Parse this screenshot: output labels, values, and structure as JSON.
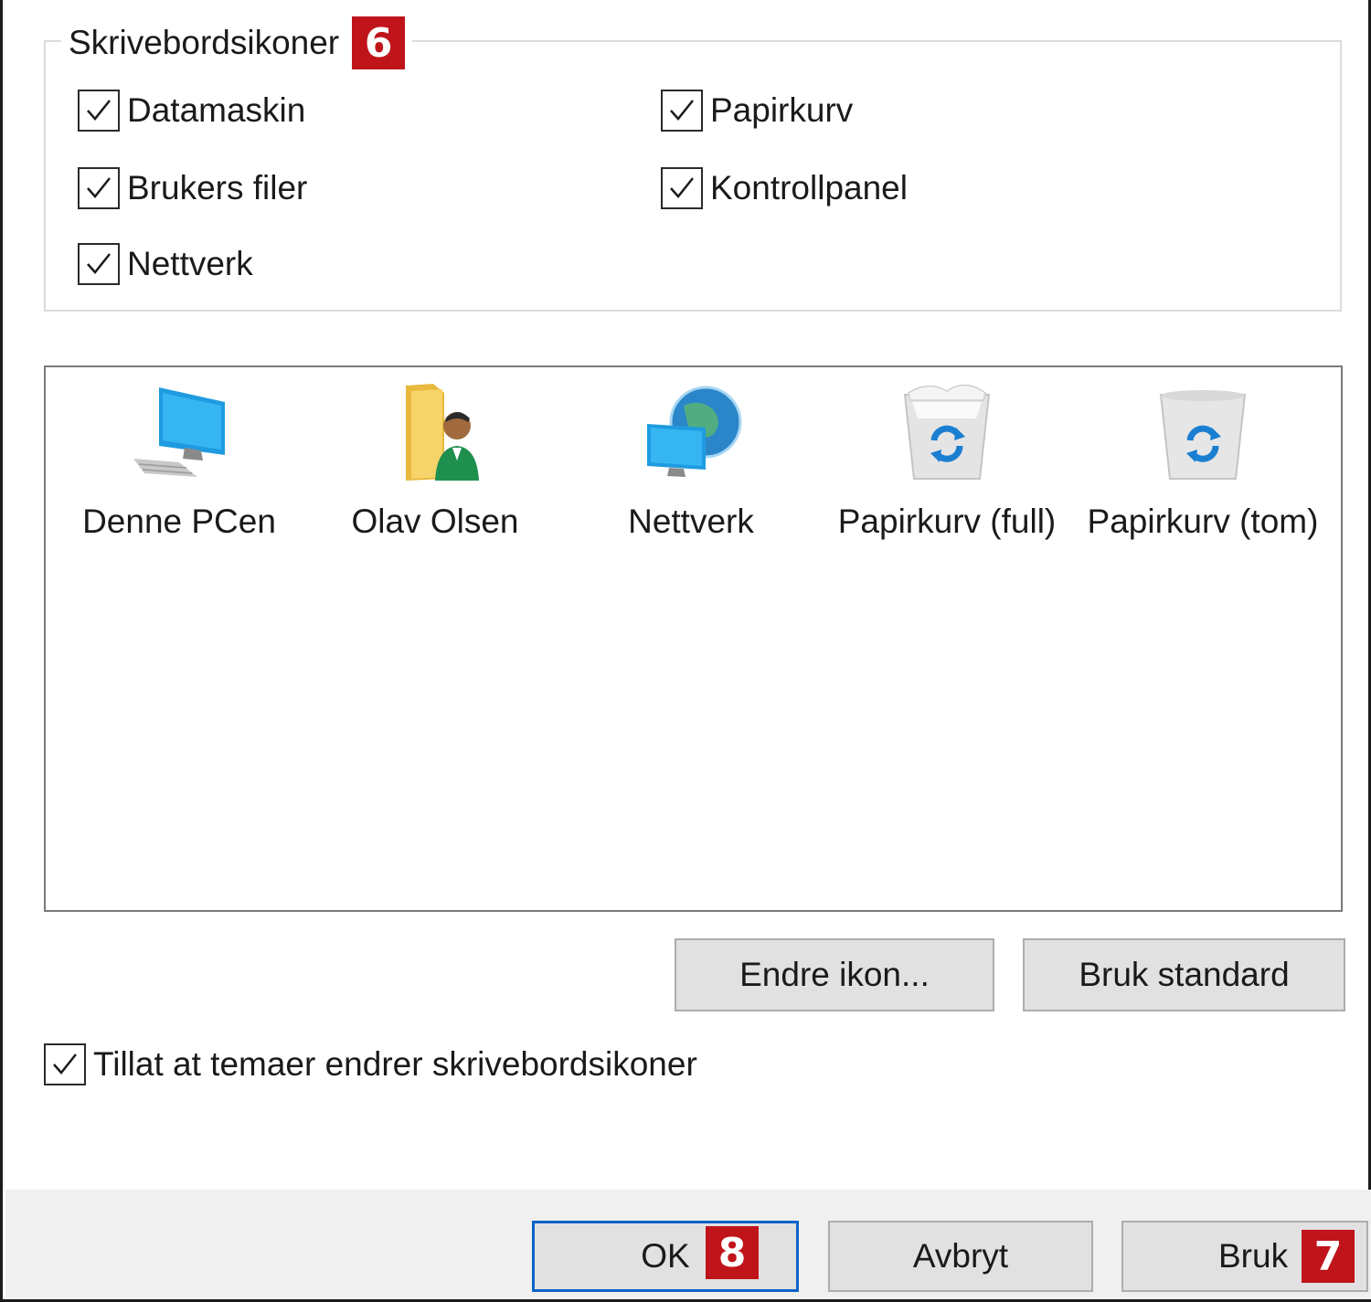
{
  "group": {
    "title": "Skrivebordsikoner",
    "badge": "6",
    "checkboxes": [
      {
        "label": "Datamaskin",
        "checked": true
      },
      {
        "label": "Papirkurv",
        "checked": true
      },
      {
        "label": "Brukers filer",
        "checked": true
      },
      {
        "label": "Kontrollpanel",
        "checked": true
      },
      {
        "label": "Nettverk",
        "checked": true
      }
    ]
  },
  "icons": [
    {
      "label": "Denne PCen",
      "icon": "computer-icon"
    },
    {
      "label": "Olav Olsen",
      "icon": "user-folder-icon"
    },
    {
      "label": "Nettverk",
      "icon": "network-icon"
    },
    {
      "label": "Papirkurv (full)",
      "icon": "recycle-bin-full-icon"
    },
    {
      "label": "Papirkurv (tom)",
      "icon": "recycle-bin-empty-icon"
    }
  ],
  "buttons": {
    "change_icon": "Endre ikon...",
    "restore_default": "Bruk standard",
    "ok": "OK",
    "cancel": "Avbryt",
    "apply": "Bruk"
  },
  "allow_themes": {
    "label": "Tillat at temaer endrer skrivebordsikoner",
    "checked": true
  },
  "badges": {
    "ok": "8",
    "apply": "7"
  },
  "colors": {
    "badge": "#c0141b",
    "ok_border": "#0b63c8",
    "footer": "#f0f0f0"
  }
}
